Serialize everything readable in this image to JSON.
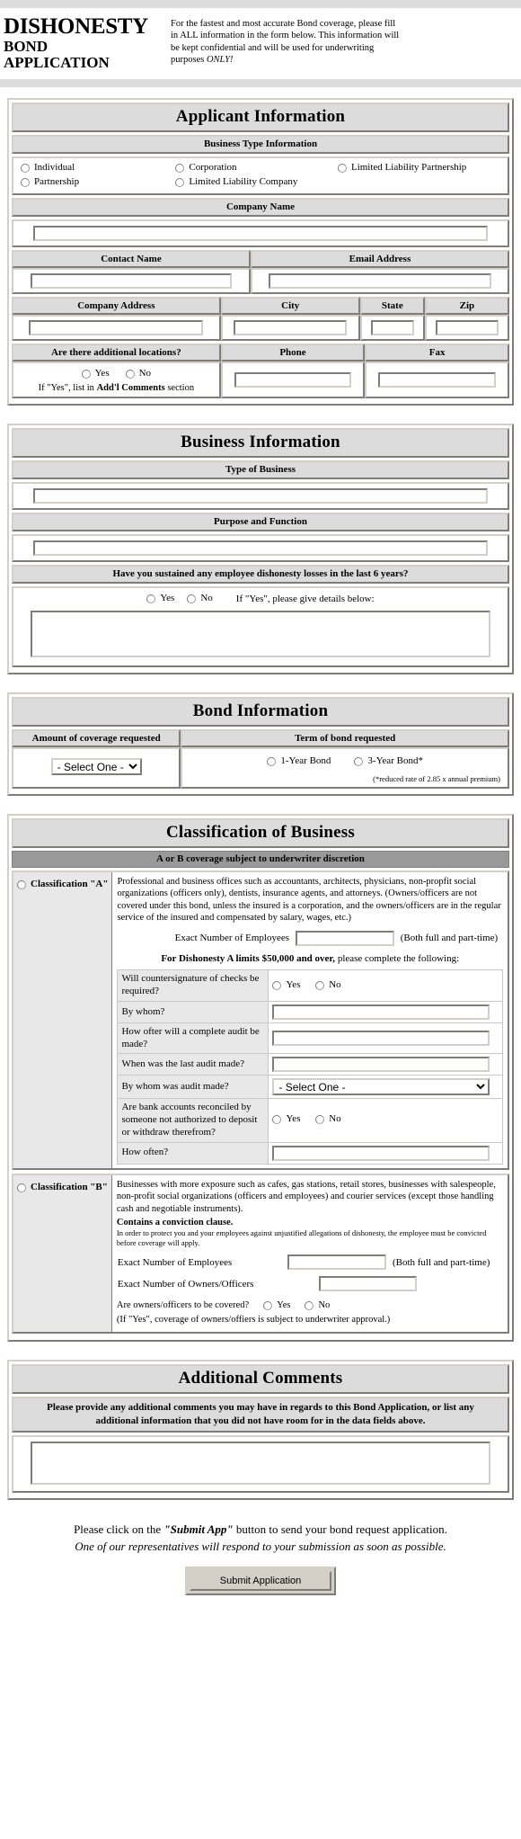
{
  "header": {
    "title_line1": "DISHONESTY",
    "title_line2": "BOND",
    "title_line3": "APPLICATION",
    "note_a": "For the fastest and most accurate Bond coverage, please fill in ALL information in the form below. This information will be kept confidential and will be used for underwriting purposes ",
    "note_b": "ONLY!"
  },
  "applicant": {
    "section_title": "Applicant Information",
    "business_type_header": "Business Type Information",
    "types": [
      "Individual",
      "Partnership",
      "Corporation",
      "Limited Liability Company",
      "Limited Liability Partnership"
    ],
    "company_name_label": "Company Name",
    "contact_name_label": "Contact Name",
    "email_label": "Email Address",
    "address_label": "Company Address",
    "city_label": "City",
    "state_label": "State",
    "zip_label": "Zip",
    "additional_locations_label": "Are there additional locations?",
    "phone_label": "Phone",
    "fax_label": "Fax",
    "yes": "Yes",
    "no": "No",
    "addl_note_pre": "If \"Yes\", list in ",
    "addl_note_bold": "Add'l Comments",
    "addl_note_post": " section"
  },
  "business": {
    "section_title": "Business Information",
    "type_of_business_label": "Type of Business",
    "purpose_label": "Purpose and Function",
    "losses_question": "Have you sustained any employee dishonesty losses in the last 6 years?",
    "yes": "Yes",
    "no": "No",
    "details_note": "If \"Yes\", please give details below:"
  },
  "bond": {
    "section_title": "Bond Information",
    "amount_label": "Amount of coverage requested",
    "term_label": "Term of bond requested",
    "select_value": "- Select One -",
    "select_options": [
      "- Select One -"
    ],
    "term_1year": "1-Year Bond",
    "term_3year": "3-Year Bond*",
    "reduced_note": "(*reduced rate of 2.85 x annual premium)"
  },
  "classification": {
    "section_title": "Classification of Business",
    "subhead": "A or B coverage subject to underwriter discretion",
    "class_a_label": "Classification \"A\"",
    "class_a_desc": "Professional and business offices such as accountants, architects, physicians, non-propfit social organizations (officers only), dentists, insurance agents, and attorneys. (Owners/officers are not covered under this bond, unless the insured is a corporation, and the owners/officers are in the regular service of the insured and compensated by salary, wages, etc.)",
    "employees_label": "Exact Number of Employees",
    "employees_note": "(Both full and part-time)",
    "limits_note_bold": "For Dishonesty A limits $50,000 and over,",
    "limits_note_rest": " please complete the following:",
    "questions": [
      "Will countersignature of checks be required?",
      "By whom?",
      "How ofter will a complete audit be made?",
      "When was the last audit made?",
      "By whom was audit made?",
      "Are bank accounts reconciled by someone not authorized to deposit or withdraw therefrom?",
      "How often?"
    ],
    "audit_select_value": "- Select One -",
    "yes": "Yes",
    "no": "No",
    "class_b_label": "Classification \"B\"",
    "class_b_desc": "Businesses with more exposure such as cafes, gas stations, retail stores, businesses with salespeople, non-profit social organizations (officers and employees) and courier services (except those handling cash and negotiable instruments).",
    "class_b_bold": "Contains a conviction clause.",
    "class_b_tiny": "In order to protect you and your employees against unjustified allegations of dishonesty, the employee must be convicted before coverage will apply.",
    "owners_label": "Exact Number of Owners/Officers",
    "owners_covered_q": "Are owners/officers to be covered?",
    "owners_covered_note": "(If \"Yes\", coverage of owners/offiers is subject to underwriter approval.)"
  },
  "comments": {
    "section_title": "Additional Comments",
    "instruction": "Please provide any additional comments you may have in regards to this Bond Application, or list any additional information that you did not have room for in the data fields above."
  },
  "footer": {
    "line1_pre": "Please click on the ",
    "line1_bold": "\"Submit App\"",
    "line1_post": " button to send your bond request application.",
    "line2": "One of our representatives will respond to your submission as soon as possible.",
    "submit_label": "Submit Application"
  }
}
